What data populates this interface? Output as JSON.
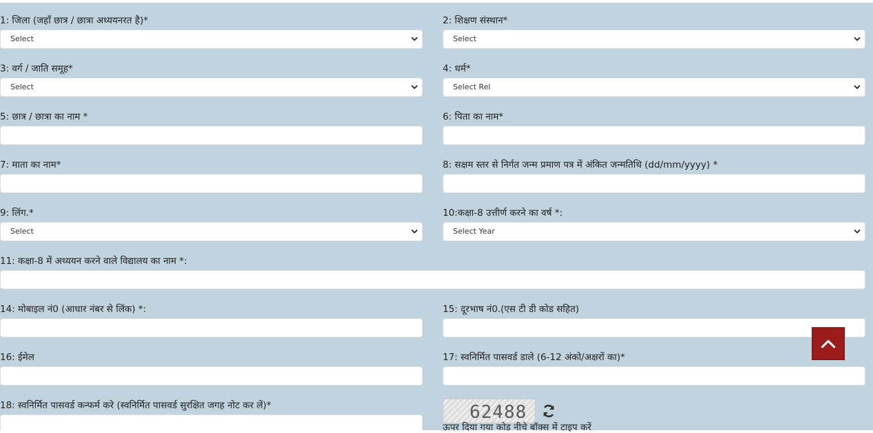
{
  "fields": {
    "district": {
      "label": "1: जिला (जहाँ छात्र / छात्रा अध्ययनरत है)*",
      "value": "Select"
    },
    "institution": {
      "label": "2: शिक्षण संस्थान*",
      "value": "Select"
    },
    "category": {
      "label": "3: वर्ग / जाति समूह*",
      "value": "Select"
    },
    "religion": {
      "label": "4: धर्म*",
      "value": "Select Rel"
    },
    "student_name": {
      "label": "5: छात्र / छात्रा का नाम *",
      "value": ""
    },
    "father_name": {
      "label": "6: पिता का नाम*",
      "value": ""
    },
    "mother_name": {
      "label": "7: माता का नाम*",
      "value": ""
    },
    "dob": {
      "label": "8: सक्षम स्तर से निर्गत जन्म प्रमाण पत्र में अंकित जन्मतिथि (dd/mm/yyyy) *",
      "value": ""
    },
    "gender": {
      "label": "9: लिंग.*",
      "value": "Select"
    },
    "class8_year": {
      "label": "10:कक्षा-8 उत्तीर्ण करने का वर्ष *:",
      "value": "Select Year"
    },
    "class8_school": {
      "label": "11: कक्षा-8 में अध्ययन करने वाले विद्यालय का नाम *:",
      "value": ""
    },
    "mobile": {
      "label": "14: मोबाइल नं0 (आधार नंबर से लिंक) *:",
      "value": ""
    },
    "phone": {
      "label": "15: दूरभाष नं0.(एस टी डी कोड सहित)",
      "value": ""
    },
    "email": {
      "label": "16: ईमेल",
      "value": ""
    },
    "password": {
      "label": "17: स्वनिर्मित पासवर्ड डाले (6-12 अंको/अक्षरों का)*",
      "value": ""
    },
    "confirm_password": {
      "label": "18: स्वनिर्मित पासवर्ड कन्फर्म करे (स्वनिर्मित पासवर्ड सुरक्षित जगह नोट कर लें)*",
      "value": ""
    }
  },
  "captcha": {
    "code": "62488",
    "hint": "ऊपर दिया गया कोड नीचे बॉक्स में टाइप करें"
  },
  "icons": {
    "back_to_top": "chevron-up-icon",
    "refresh": "refresh-icon",
    "dropdown": "chevron-down-icon"
  },
  "colors": {
    "form_bg": "#c0d3de",
    "back_to_top_bg": "#9b1a1a"
  }
}
